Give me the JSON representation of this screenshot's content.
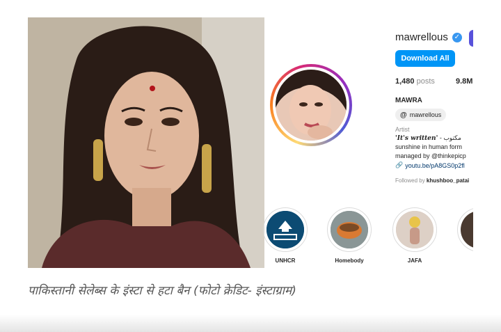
{
  "profile": {
    "username": "mawrellous",
    "download_label": "Download All",
    "posts_count": "1,480",
    "posts_label": "posts",
    "followers_count": "9.8M",
    "name": "MAWRA",
    "threads_handle": "mawrellous",
    "category": "Artist",
    "bio_line1_italic": "'It's written'",
    "bio_line1_rest": " - مكتوب",
    "bio_line2": "sunshine in human form",
    "bio_line3": "managed by @thinkepicp",
    "link": "youtu.be/pA8GS0p2fl",
    "followed_by_prefix": "Followed by ",
    "followed_by_user": "khushboo_patai",
    "accent": "#0095f6"
  },
  "highlights": [
    {
      "label": "UNHCR",
      "icon": "unhcr-logo-icon"
    },
    {
      "label": "Homebody",
      "icon": "bowl-icon"
    },
    {
      "label": "JAFA",
      "icon": "person-photo"
    },
    {
      "label": "",
      "icon": "partial-highlight"
    }
  ],
  "caption": "पाकिस्तानी सेलेब्स के इंस्टा से हटा बैन (फोटो क्रेडिट- इंस्टाग्राम)"
}
